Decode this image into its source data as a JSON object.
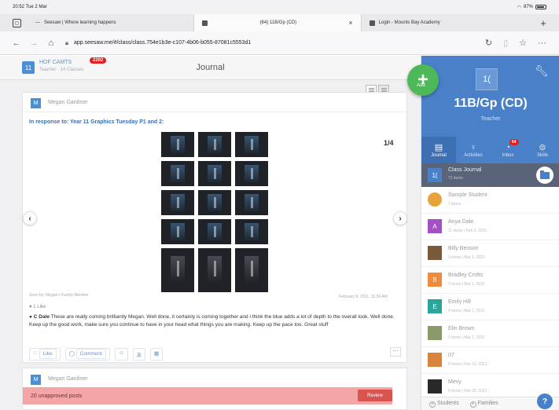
{
  "status_bar": {
    "time_date": "20:52  Tue 2 Mar",
    "battery": "87%"
  },
  "tabs": [
    {
      "label": "Seesaw | Where learning happens"
    },
    {
      "label": "(64) 11B/Gp (CD)"
    },
    {
      "label": "Login - Mounts Bay Academy"
    }
  ],
  "address_bar": {
    "url": "app.seesaw.me/#/class/class.754e1b3e-c107-4b06-b055-87081c5553d1"
  },
  "header": {
    "class_badge": "11",
    "class_name": "HOF CAMTS",
    "class_sub": "Teacher · 14 Classes",
    "notification_count": "2202",
    "title": "Journal"
  },
  "fab": {
    "label": "Add"
  },
  "post": {
    "author_initial": "M",
    "author": "Megan Gardiner",
    "response_to": "In response to: Year 11 Graphics Tuesday P1 and 2:",
    "counter": "1/4",
    "posted_by": "Seen by: Megan's Family Member",
    "date": "February 8, 2021, 11:36 AM",
    "likes": "1 Like",
    "comment_author": "C Dale",
    "comment_text": "These are really coming brilliantly Megan. Well done, it certainly is coming together and i think the blue adds a lot of depth to the overall look. Well done. Keep up the good work, make sure you continue to have in your head what things you are making. Keep up the pace too. Great stuff",
    "actions": {
      "like": "Like",
      "comment": "Comment"
    }
  },
  "post2": {
    "author_initial": "M",
    "author": "Megan Gardiner",
    "unapproved": "20 unapproved posts",
    "review_label": "Review"
  },
  "panel": {
    "class_logo": "1(",
    "class_name": "11B/Gp (CD)",
    "role": "Teacher",
    "tabs": [
      {
        "label": "Journal"
      },
      {
        "label": "Activities"
      },
      {
        "label": "Inbox",
        "badge": "64"
      },
      {
        "label": "Skills"
      }
    ],
    "journal_row": {
      "initial": "1(",
      "name": "Class Journal",
      "sub": "72 items"
    },
    "students": [
      {
        "initial": "",
        "name": "Sample Student",
        "sub": "7 items",
        "color": "#e6a33b"
      },
      {
        "initial": "A",
        "name": "Anya Dale",
        "sub": "11 items | Feb 3, 2021",
        "color": "#a44fc5"
      },
      {
        "initial": "",
        "name": "Billy Benson",
        "sub": "3 items | Mar 1, 2021",
        "color": "#7a5a3a"
      },
      {
        "initial": "B",
        "name": "Bradley Crofts",
        "sub": "3 items | Mar 1, 2021",
        "color": "#f08a3c"
      },
      {
        "initial": "E",
        "name": "Emily Hill",
        "sub": "4 items | Mar 1, 2021",
        "color": "#2aa59a"
      },
      {
        "initial": "",
        "name": "Elin Brown",
        "sub": "2 items | Mar 1, 2021",
        "color": "#8a9a6a"
      },
      {
        "initial": "",
        "name": "07",
        "sub": "8 items | Feb 10, 2021",
        "color": "#d8843a"
      },
      {
        "initial": "",
        "name": "Mevy",
        "sub": "6 items | Feb 28, 2021",
        "color": "#2a2a2a"
      }
    ],
    "footer": {
      "students": "Students",
      "families": "Families"
    }
  }
}
